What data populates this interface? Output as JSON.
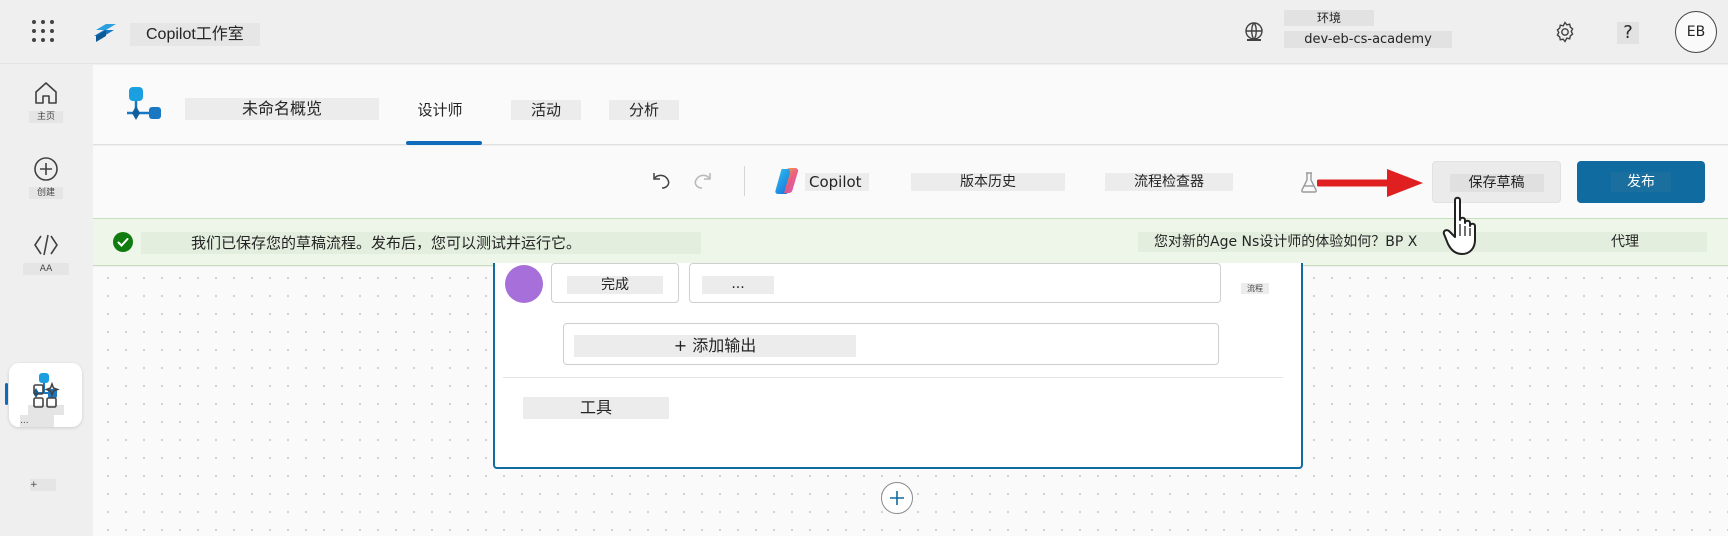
{
  "topbar": {
    "app_name": "Copilot工作室",
    "env_label": "环境",
    "env_value": "dev-eb-cs-academy",
    "help_label": "?",
    "avatar_initials": "EB",
    "icons": [
      "waffle-icon",
      "copilot-studio-logo",
      "environment-icon",
      "gear-icon",
      "help-icon"
    ]
  },
  "leftrail": {
    "items": [
      {
        "name": "home",
        "label": "主页"
      },
      {
        "name": "create",
        "label": "创建"
      },
      {
        "name": "agents",
        "label": "AA"
      },
      {
        "name": "flows",
        "label": ""
      },
      {
        "name": "more",
        "label": "..."
      },
      {
        "name": "plus",
        "label": "+"
      }
    ]
  },
  "header": {
    "flow_name": "未命名概览",
    "tabs": [
      {
        "label": "设计师",
        "active": true
      },
      {
        "label": "活动",
        "active": false
      },
      {
        "label": "分析",
        "active": false
      }
    ]
  },
  "toolbar": {
    "copilot_label": "Copilot",
    "version_history_label": "版本历史",
    "flow_checker_label": "流程检查器",
    "save_draft_label": "保存草稿",
    "publish_label": "发布"
  },
  "banner": {
    "message": "我们已保存您的草稿流程。发布后，您可以测试并运行它。",
    "feedback": "您对新的Age Ns设计师的体验如何？BP X",
    "agent_label": "代理"
  },
  "canvas": {
    "node": {
      "avatar_text": "",
      "done_label": "完成",
      "field_value": "...",
      "flow_tag": "流程",
      "add_output_label": "+ 添加输出",
      "tools_label": "工具"
    }
  },
  "colors": {
    "accent": "#0f6cbd",
    "publish": "#0f6ba0",
    "banner_bg": "#eef6ea",
    "success": "#107c10",
    "arrow": "#e02020",
    "node_avatar": "#a66fd9"
  }
}
